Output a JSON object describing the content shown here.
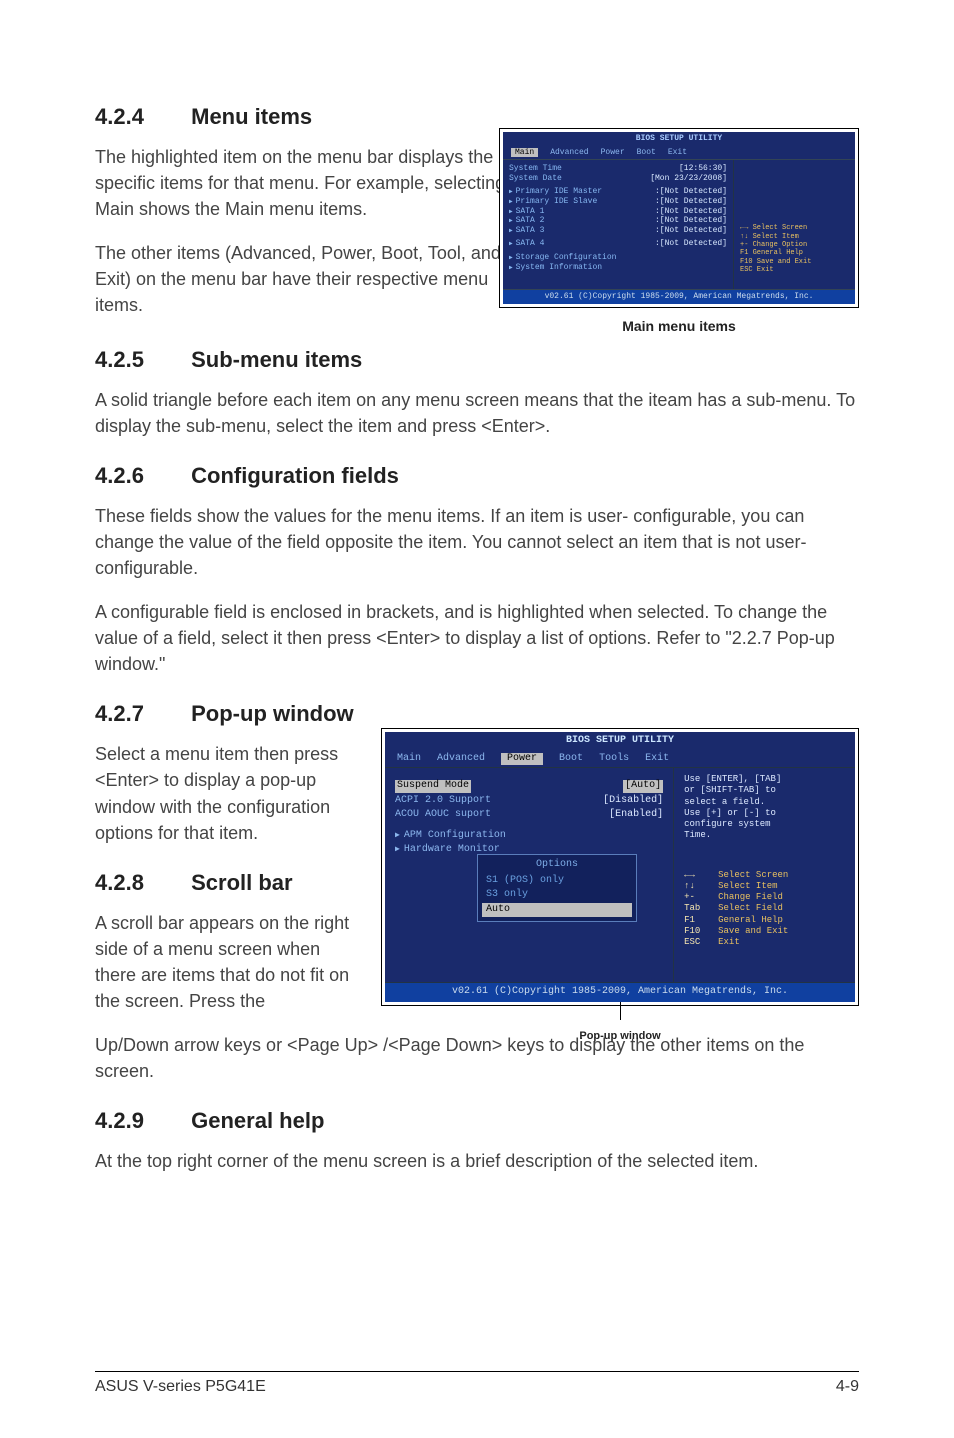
{
  "s424": {
    "heading_num": "4.2.4",
    "heading": "Menu items",
    "p1": "The highlighted item on the menu bar  displays the specific items for that menu. For example, selecting Main shows the Main menu items.",
    "p2": "The other items (Advanced, Power, Boot, Tool, and Exit) on the menu bar have their respective menu items."
  },
  "fig1": {
    "title": "BIOS SETUP UTILITY",
    "menubar": [
      "Main",
      "Advanced",
      "Power",
      "Boot",
      "Exit"
    ],
    "rows": [
      {
        "lbl": "System Time",
        "val": "[12:56:30]"
      },
      {
        "lbl": "System Date",
        "val": "[Mon 23/23/2008]"
      },
      {
        "lbl": "Primary IDE Master",
        "val": ":[Not Detected]",
        "tri": true
      },
      {
        "lbl": "Primary IDE Slave",
        "val": ":[Not Detected]",
        "tri": true
      },
      {
        "lbl": "SATA 1",
        "val": ":[Not Detected]",
        "tri": true
      },
      {
        "lbl": "SATA 2",
        "val": ":[Not Detected]",
        "tri": true
      },
      {
        "lbl": "SATA 3",
        "val": ":[Not Detected]",
        "tri": true
      },
      {
        "lbl": "SATA 4",
        "val": ":[Not Detected]",
        "tri": true
      },
      {
        "lbl": "Storage Configuration",
        "val": "",
        "tri": true
      },
      {
        "lbl": "System Information",
        "val": "",
        "tri": true
      }
    ],
    "legend": [
      "←→  Select Screen",
      "↑↓  Select Item",
      "+-  Change Option",
      "F1  General Help",
      "F10 Save and Exit",
      "ESC Exit"
    ],
    "copyright": "v02.61 (C)Copyright 1985-2009, American Megatrends, Inc.",
    "caption": "Main menu items"
  },
  "s425": {
    "heading_num": "4.2.5",
    "heading": "Sub-menu items",
    "p1": "A solid triangle before each item on any menu screen means that the iteam has a sub-menu. To display the sub-menu, select the item and press <Enter>."
  },
  "s426": {
    "heading_num": "4.2.6",
    "heading": "Configuration fields",
    "p1": "These fields show the values for the menu items. If an item is user- configurable, you can change the value of the field opposite the item. You cannot select an item that is not user-configurable.",
    "p2": "A configurable field is enclosed in brackets, and is highlighted when selected. To change the value of a field, select it then press <Enter> to display a list of options. Refer to \"2.2.7 Pop-up window.\""
  },
  "s427": {
    "heading_num": "4.2.7",
    "heading": "Pop-up window",
    "p1": "Select a menu item then press <Enter> to display a pop-up window with the configuration options for that item."
  },
  "fig2": {
    "title": "BIOS SETUP UTILITY",
    "menubar": [
      "Main",
      "Advanced",
      "Power",
      "Boot",
      "Tools",
      "Exit"
    ],
    "rows": [
      {
        "lbl": "Suspend Mode",
        "val": "[Auto]",
        "sel": true
      },
      {
        "lbl": "ACPI 2.0 Support",
        "val": "[Disabled]"
      },
      {
        "lbl": "ACOU AOUC suport",
        "val": "[Enabled]"
      },
      {
        "lbl": "APM Configuration",
        "val": "",
        "tri": true
      },
      {
        "lbl": "Hardware Monitor",
        "val": "",
        "tri": true
      }
    ],
    "popup": {
      "title": "Options",
      "opts": [
        "S1 (POS) only",
        "S3 only",
        "Auto"
      ],
      "sel": 2
    },
    "help_top": [
      "Use [ENTER], [TAB]",
      "or [SHIFT-TAB] to",
      "select a field.",
      "",
      "Use [+] or [-] to",
      "configure system",
      "Time."
    ],
    "legend": [
      {
        "k": "←→",
        "t": "Select Screen"
      },
      {
        "k": "↑↓",
        "t": "Select Item"
      },
      {
        "k": "+-",
        "t": "Change Field"
      },
      {
        "k": "Tab",
        "t": "Select Field"
      },
      {
        "k": "F1",
        "t": "General Help"
      },
      {
        "k": "F10",
        "t": "Save and Exit"
      },
      {
        "k": "ESC",
        "t": "Exit"
      }
    ],
    "copyright": "v02.61 (C)Copyright 1985-2009, American Megatrends, Inc.",
    "caption": "Pop-up window"
  },
  "s428": {
    "heading_num": "4.2.8",
    "heading": "Scroll bar",
    "p1": "A scroll bar appears on the right side of a menu screen when there are items that do not fit on the screen. Press the",
    "p2": "Up/Down arrow keys or <Page Up> /<Page Down> keys to display the other items on the screen."
  },
  "s429": {
    "heading_num": "4.2.9",
    "heading": "General help",
    "p1": "At the top right corner of the menu screen is a brief description of the selected item."
  },
  "footer": {
    "left": "ASUS V-series P5G41E",
    "right": "4-9"
  }
}
